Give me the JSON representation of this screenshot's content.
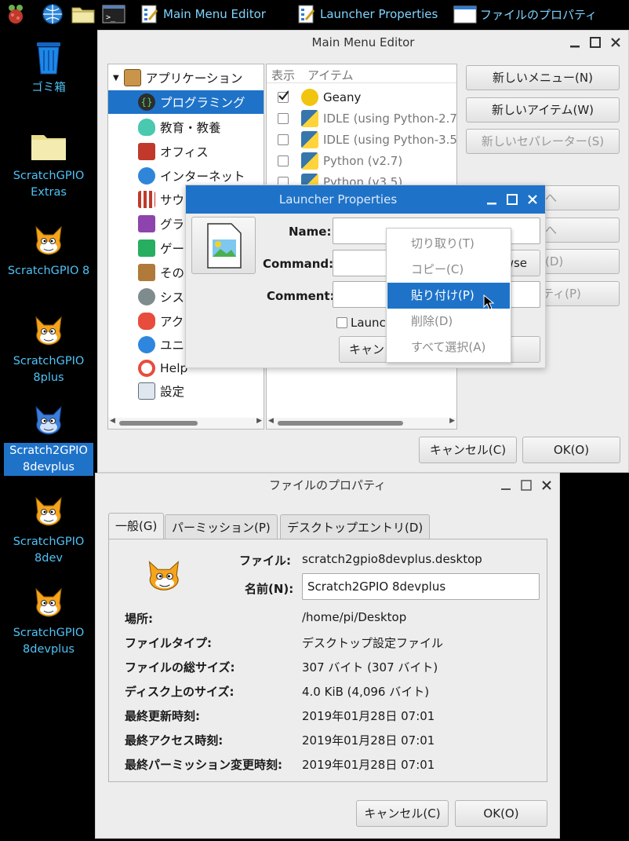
{
  "taskbar": {
    "tasks": [
      {
        "label": "Main Menu Editor",
        "icon": "menu-editor-icon"
      },
      {
        "label": "Launcher Properties",
        "icon": "menu-editor-icon"
      },
      {
        "label": "ファイルのプロパティ",
        "icon": "window-icon"
      }
    ]
  },
  "desktop": {
    "icons": [
      {
        "label": "ゴミ箱",
        "icon": "trash-icon"
      },
      {
        "label": "ScratchGPIO\nExtras",
        "icon": "folder-icon"
      },
      {
        "label": "ScratchGPIO 8",
        "icon": "scratch-cat-icon"
      },
      {
        "label": "ScratchGPIO\n8plus",
        "icon": "scratch-cat-icon"
      },
      {
        "label": "Scratch2GPIO\n8devplus",
        "icon": "scratch-cat-icon",
        "selected": true
      },
      {
        "label": "ScratchGPIO\n8dev",
        "icon": "scratch-cat-icon"
      },
      {
        "label": "ScratchGPIO\n8devplus",
        "icon": "scratch-cat-icon"
      }
    ]
  },
  "main_menu_editor": {
    "title": "Main Menu Editor",
    "tree": [
      {
        "label": "アプリケーション",
        "icon": "folder-icon"
      },
      {
        "label": "プログラミング",
        "icon": "programming-icon",
        "selected": true
      },
      {
        "label": "教育・教養",
        "icon": "education-icon"
      },
      {
        "label": "オフィス",
        "icon": "office-icon"
      },
      {
        "label": "インターネット",
        "icon": "internet-icon"
      },
      {
        "label": "サウ",
        "icon": "sound-icon"
      },
      {
        "label": "グラ",
        "icon": "graphics-icon"
      },
      {
        "label": "ゲー",
        "icon": "games-icon"
      },
      {
        "label": "その",
        "icon": "other-icon"
      },
      {
        "label": "シス",
        "icon": "system-icon"
      },
      {
        "label": "アク",
        "icon": "accessories-icon"
      },
      {
        "label": "ユニ",
        "icon": "universal-access-icon"
      },
      {
        "label": "Help",
        "icon": "help-icon"
      },
      {
        "label": "設定",
        "icon": "settings-icon"
      }
    ],
    "list_headers": {
      "show": "表示",
      "item": "アイテム"
    },
    "list_items": [
      {
        "label": "Geany",
        "checked": true,
        "icon": "geany-icon"
      },
      {
        "label": "IDLE (using Python-2.7)",
        "checked": false,
        "icon": "python-icon"
      },
      {
        "label": "IDLE (using Python-3.5)",
        "checked": false,
        "icon": "python-icon"
      },
      {
        "label": "Python (v2.7)",
        "checked": false,
        "icon": "python-icon"
      },
      {
        "label": "Python (v3.5)",
        "checked": false,
        "icon": "python-icon"
      }
    ],
    "buttons": {
      "new_menu": "新しいメニュー(N)",
      "new_item": "新しいアイテム(W)",
      "new_separator": "新しいセパレーター(S)",
      "up": "へ",
      "down": "へ",
      "delete": "(D)",
      "properties": "ティ(P)",
      "cancel": "キャンセル(C)",
      "ok": "OK(O)"
    }
  },
  "launcher_properties": {
    "title": "Launcher Properties",
    "name_label": "Name:",
    "command_label": "Command:",
    "comment_label": "Comment:",
    "browse_label": "wse",
    "launch_label": "Launc",
    "cancel_label": "キャン"
  },
  "context_menu": {
    "items": [
      {
        "label": "切り取り(T)",
        "highlighted": false
      },
      {
        "label": "コピー(C)",
        "highlighted": false
      },
      {
        "label": "貼り付け(P)",
        "highlighted": true
      },
      {
        "label": "削除(D)",
        "highlighted": false
      },
      {
        "label": "すべて選択(A)",
        "highlighted": false
      }
    ]
  },
  "file_properties": {
    "title": "ファイルのプロパティ",
    "tabs": [
      "一般(G)",
      "パーミッション(P)",
      "デスクトップエントリ(D)"
    ],
    "file_label": "ファイル:",
    "file_value": "scratch2gpio8devplus.desktop",
    "name_label": "名前(N):",
    "name_value": "Scratch2GPIO 8devplus",
    "rows": [
      {
        "label": "場所:",
        "value": "/home/pi/Desktop"
      },
      {
        "label": "ファイルタイプ:",
        "value": "デスクトップ設定ファイル"
      },
      {
        "label": "ファイルの総サイズ:",
        "value": "307 バイト (307 バイト)"
      },
      {
        "label": "ディスク上のサイズ:",
        "value": "4.0 KiB (4,096 バイト)"
      },
      {
        "label": "最終更新時刻:",
        "value": "2019年01月28日 07:01"
      },
      {
        "label": "最終アクセス時刻:",
        "value": "2019年01月28日 07:01"
      },
      {
        "label": "最終パーミッション変更時刻:",
        "value": "2019年01月28日 07:01"
      }
    ],
    "cancel": "キャンセル(C)",
    "ok": "OK(O)"
  }
}
